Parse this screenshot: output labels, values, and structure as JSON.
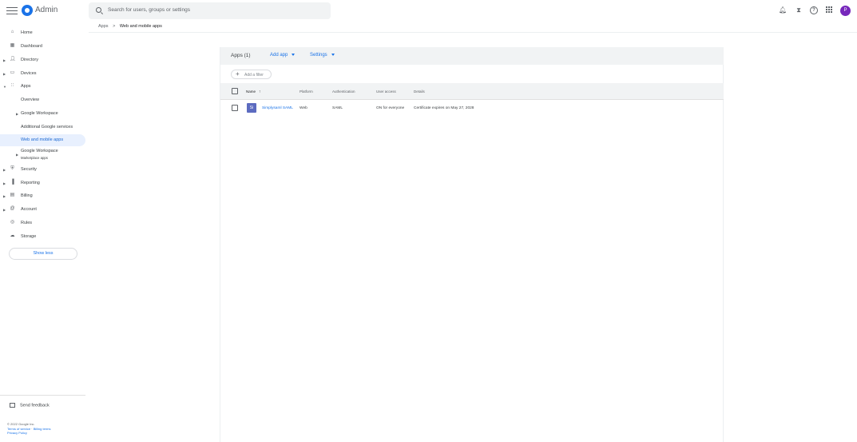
{
  "header": {
    "brand": "Admin",
    "search_placeholder": "Search for users, groups or settings",
    "avatar_letter": "P",
    "icons": [
      "menu-icon",
      "admin-logo-icon",
      "search-icon",
      "bell-icon",
      "hourglass-icon",
      "help-icon",
      "apps-grid-icon"
    ]
  },
  "breadcrumb": {
    "parent": "Apps",
    "separator": ">",
    "current": "Web and mobile apps"
  },
  "sidebar": {
    "items": [
      {
        "label": "Home",
        "icon": "home-icon"
      },
      {
        "label": "Dashboard",
        "icon": "dashboard-icon"
      },
      {
        "label": "Directory",
        "icon": "person-icon"
      },
      {
        "label": "Devices",
        "icon": "devices-icon"
      },
      {
        "label": "Apps",
        "icon": "apps-grid-icon"
      },
      {
        "label": "Overview"
      },
      {
        "label": "Google Workspace"
      },
      {
        "label": "Additional Google services"
      },
      {
        "label": "Web and mobile apps"
      },
      {
        "label": "Google Workspace",
        "sublabel": "Marketplace apps"
      },
      {
        "label": "Security",
        "icon": "shield-icon"
      },
      {
        "label": "Reporting",
        "icon": "bar-chart-icon"
      },
      {
        "label": "Billing",
        "icon": "credit-card-icon"
      },
      {
        "label": "Account",
        "icon": "at-sign-icon"
      },
      {
        "label": "Rules",
        "icon": "target-icon"
      },
      {
        "label": "Storage",
        "icon": "cloud-icon"
      }
    ],
    "show_less": "Show less",
    "send_feedback": "Send feedback",
    "footer": {
      "copyright": "© 2022 Google Inc.",
      "terms": "Terms of service",
      "billing_terms": "Billing terms",
      "privacy": "Privacy Policy"
    }
  },
  "panel": {
    "apps_count": "Apps (1)",
    "add_app": "Add app",
    "settings": "Settings",
    "add_filter": "Add a filter",
    "columns": [
      "Name",
      "Platform",
      "Authentication",
      "User access",
      "Details"
    ],
    "sort_indicator": "↑",
    "rows": [
      {
        "tile": "Si",
        "name": "Simplysaml SAML",
        "platform": "Web",
        "authentication": "SAML",
        "user_access": "ON for everyone",
        "details": "Certificate expires on May 27, 2028"
      }
    ]
  },
  "colors": {
    "accent": "#1a73e8",
    "active_bg": "#e8f0fe",
    "avatar": "#7627bb",
    "app_tile": "#5c6bc0"
  }
}
